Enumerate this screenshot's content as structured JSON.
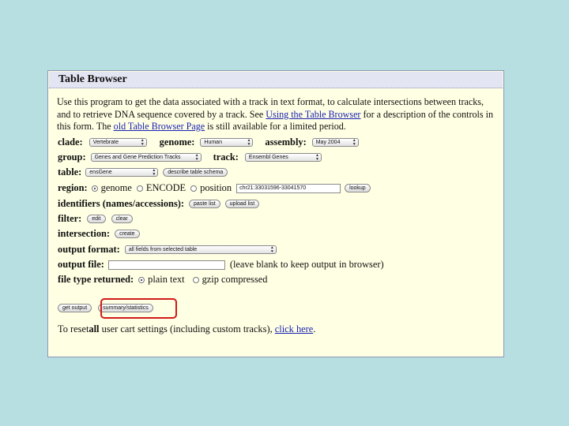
{
  "panel": {
    "title": "Table Browser"
  },
  "description": {
    "part1": "Use this program to get the data associated with a track in text format, to calculate intersections between tracks, and to retrieve DNA sequence covered by a track. See ",
    "link1": "Using the Table Browser",
    "part2": " for a description of the controls in this form. The ",
    "link2": "old Table Browser Page",
    "part3": " is still available for a limited period."
  },
  "form": {
    "clade_label": "clade:",
    "clade_value": "Vertebrate",
    "genome_label": "genome:",
    "genome_value": "Human",
    "assembly_label": "assembly:",
    "assembly_value": "May 2004",
    "group_label": "group:",
    "group_value": "Genes and Gene Prediction Tracks",
    "track_label": "track:",
    "track_value": "Ensembl Genes",
    "table_label": "table:",
    "table_value": "ensGene",
    "describe_schema_label": "describe table schema",
    "region_label": "region:",
    "region_genome": "genome",
    "region_encode": "ENCODE",
    "region_position": "position",
    "position_value": "chr21:33031596-33041570",
    "lookup_label": "lookup",
    "identifiers_label": "identifiers (names/accessions):",
    "paste_list_label": "paste list",
    "upload_list_label": "upload list",
    "filter_label": "filter:",
    "filter_edit_label": "edit",
    "filter_clear_label": "clear",
    "intersection_label": "intersection:",
    "intersection_create_label": "create",
    "output_format_label": "output format:",
    "output_format_value": "all fields from selected table",
    "output_file_label": "output file:",
    "output_file_hint": "(leave blank to keep output in browser)",
    "file_type_label": "file type returned:",
    "file_type_plain": "plain text",
    "file_type_gzip": "gzip compressed",
    "get_output_label": "get output",
    "summary_statistics_label": "summary/statistics"
  },
  "reset": {
    "prefix": "To reset ",
    "bold": "all",
    "middle": " user cart settings (including custom tracks), ",
    "link": "click here",
    "suffix": "."
  },
  "colors": {
    "background": "#b7dfe2",
    "panel": "#ffffe4",
    "title_bar": "#e3e5f2",
    "link": "#1a22b0",
    "highlight": "#d21a1a"
  }
}
